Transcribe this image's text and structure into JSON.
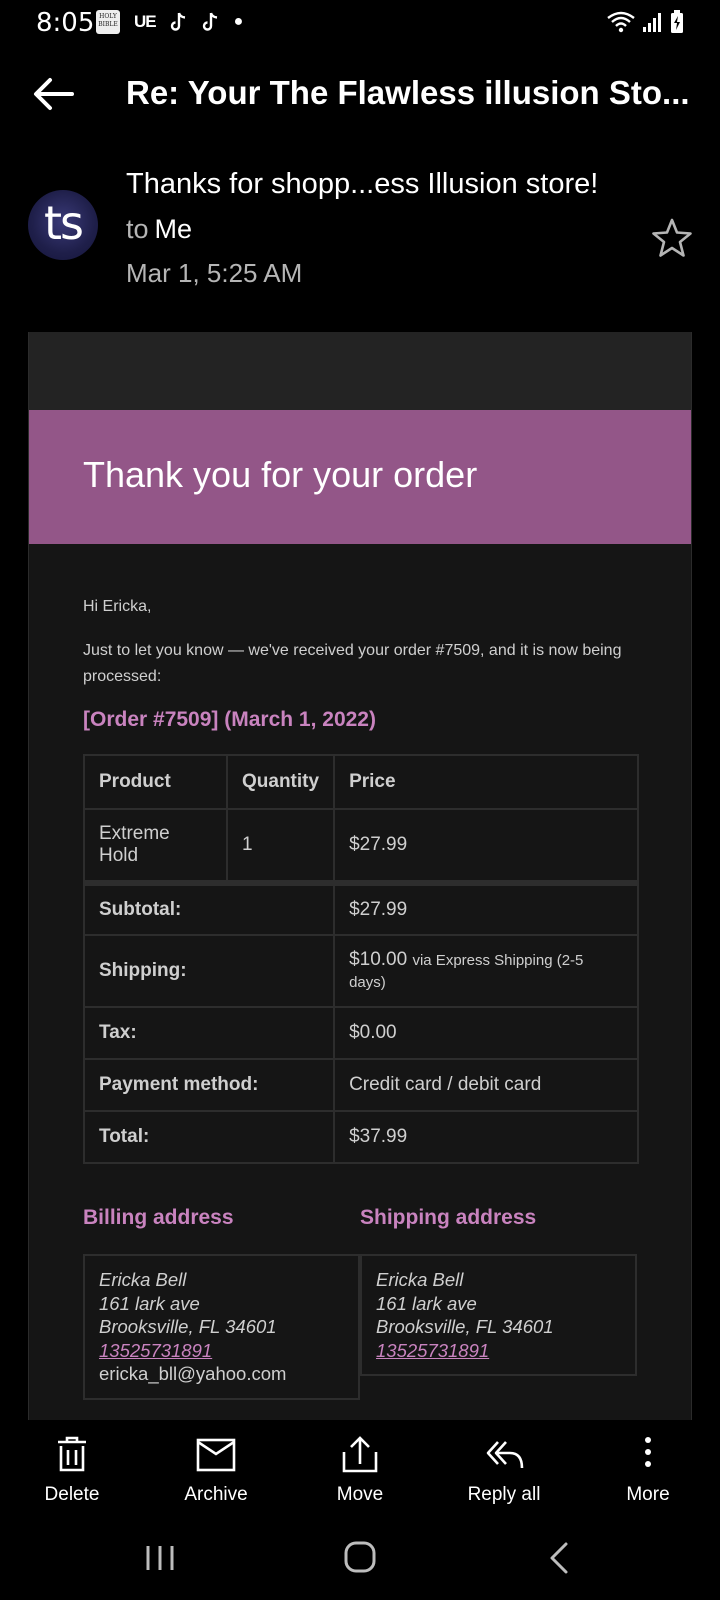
{
  "status_bar": {
    "time": "8:05",
    "left_icons": [
      "bible-app-icon",
      "ue-icon",
      "tiktok-icon",
      "tiktok-icon",
      "dot-icon"
    ],
    "ue_text": "UE",
    "right_icons": [
      "wifi-icon",
      "signal-icon",
      "battery-charging-icon"
    ]
  },
  "header": {
    "subject": "Re: Your The Flawless illusion Sto..."
  },
  "sender": {
    "avatar_text": "ts",
    "snippet": "Thanks for shopp...ess Illusion store!",
    "to_label": "to",
    "recipient": "Me",
    "date": "Mar 1, 5:25 AM"
  },
  "email": {
    "banner_title": "Thank you for your order",
    "banner_color": "#935688",
    "greeting": "Hi Ericka,",
    "intro": "Just to let you know — we've received your order #7509, and it is now being processed:",
    "order_heading": "[Order #7509] (March 1, 2022)",
    "table": {
      "headers": [
        "Product",
        "Quantity",
        "Price"
      ],
      "items": [
        {
          "product": "Extreme Hold",
          "quantity": "1",
          "price": "$27.99"
        }
      ],
      "subtotal_label": "Subtotal:",
      "subtotal": "$27.99",
      "shipping_label": "Shipping:",
      "shipping_amount": "$10.00",
      "shipping_via": "via Express Shipping (2-5 days)",
      "tax_label": "Tax:",
      "tax": "$0.00",
      "payment_label": "Payment method:",
      "payment": "Credit card / debit card",
      "total_label": "Total:",
      "total": "$37.99"
    },
    "billing": {
      "heading": "Billing address",
      "name": "Ericka Bell",
      "street": "161 lark ave",
      "city": "Brooksville, FL 34601",
      "phone": "13525731891",
      "email": "ericka_bll@yahoo.com"
    },
    "shipping": {
      "heading": "Shipping address",
      "name": "Ericka Bell",
      "street": "161 lark ave",
      "city": "Brooksville, FL 34601",
      "phone": "13525731891"
    }
  },
  "actions": {
    "delete": "Delete",
    "archive": "Archive",
    "move": "Move",
    "reply_all": "Reply all",
    "more": "More"
  },
  "colors": {
    "accent": "#c983bf",
    "banner": "#935688",
    "background": "#000000"
  }
}
